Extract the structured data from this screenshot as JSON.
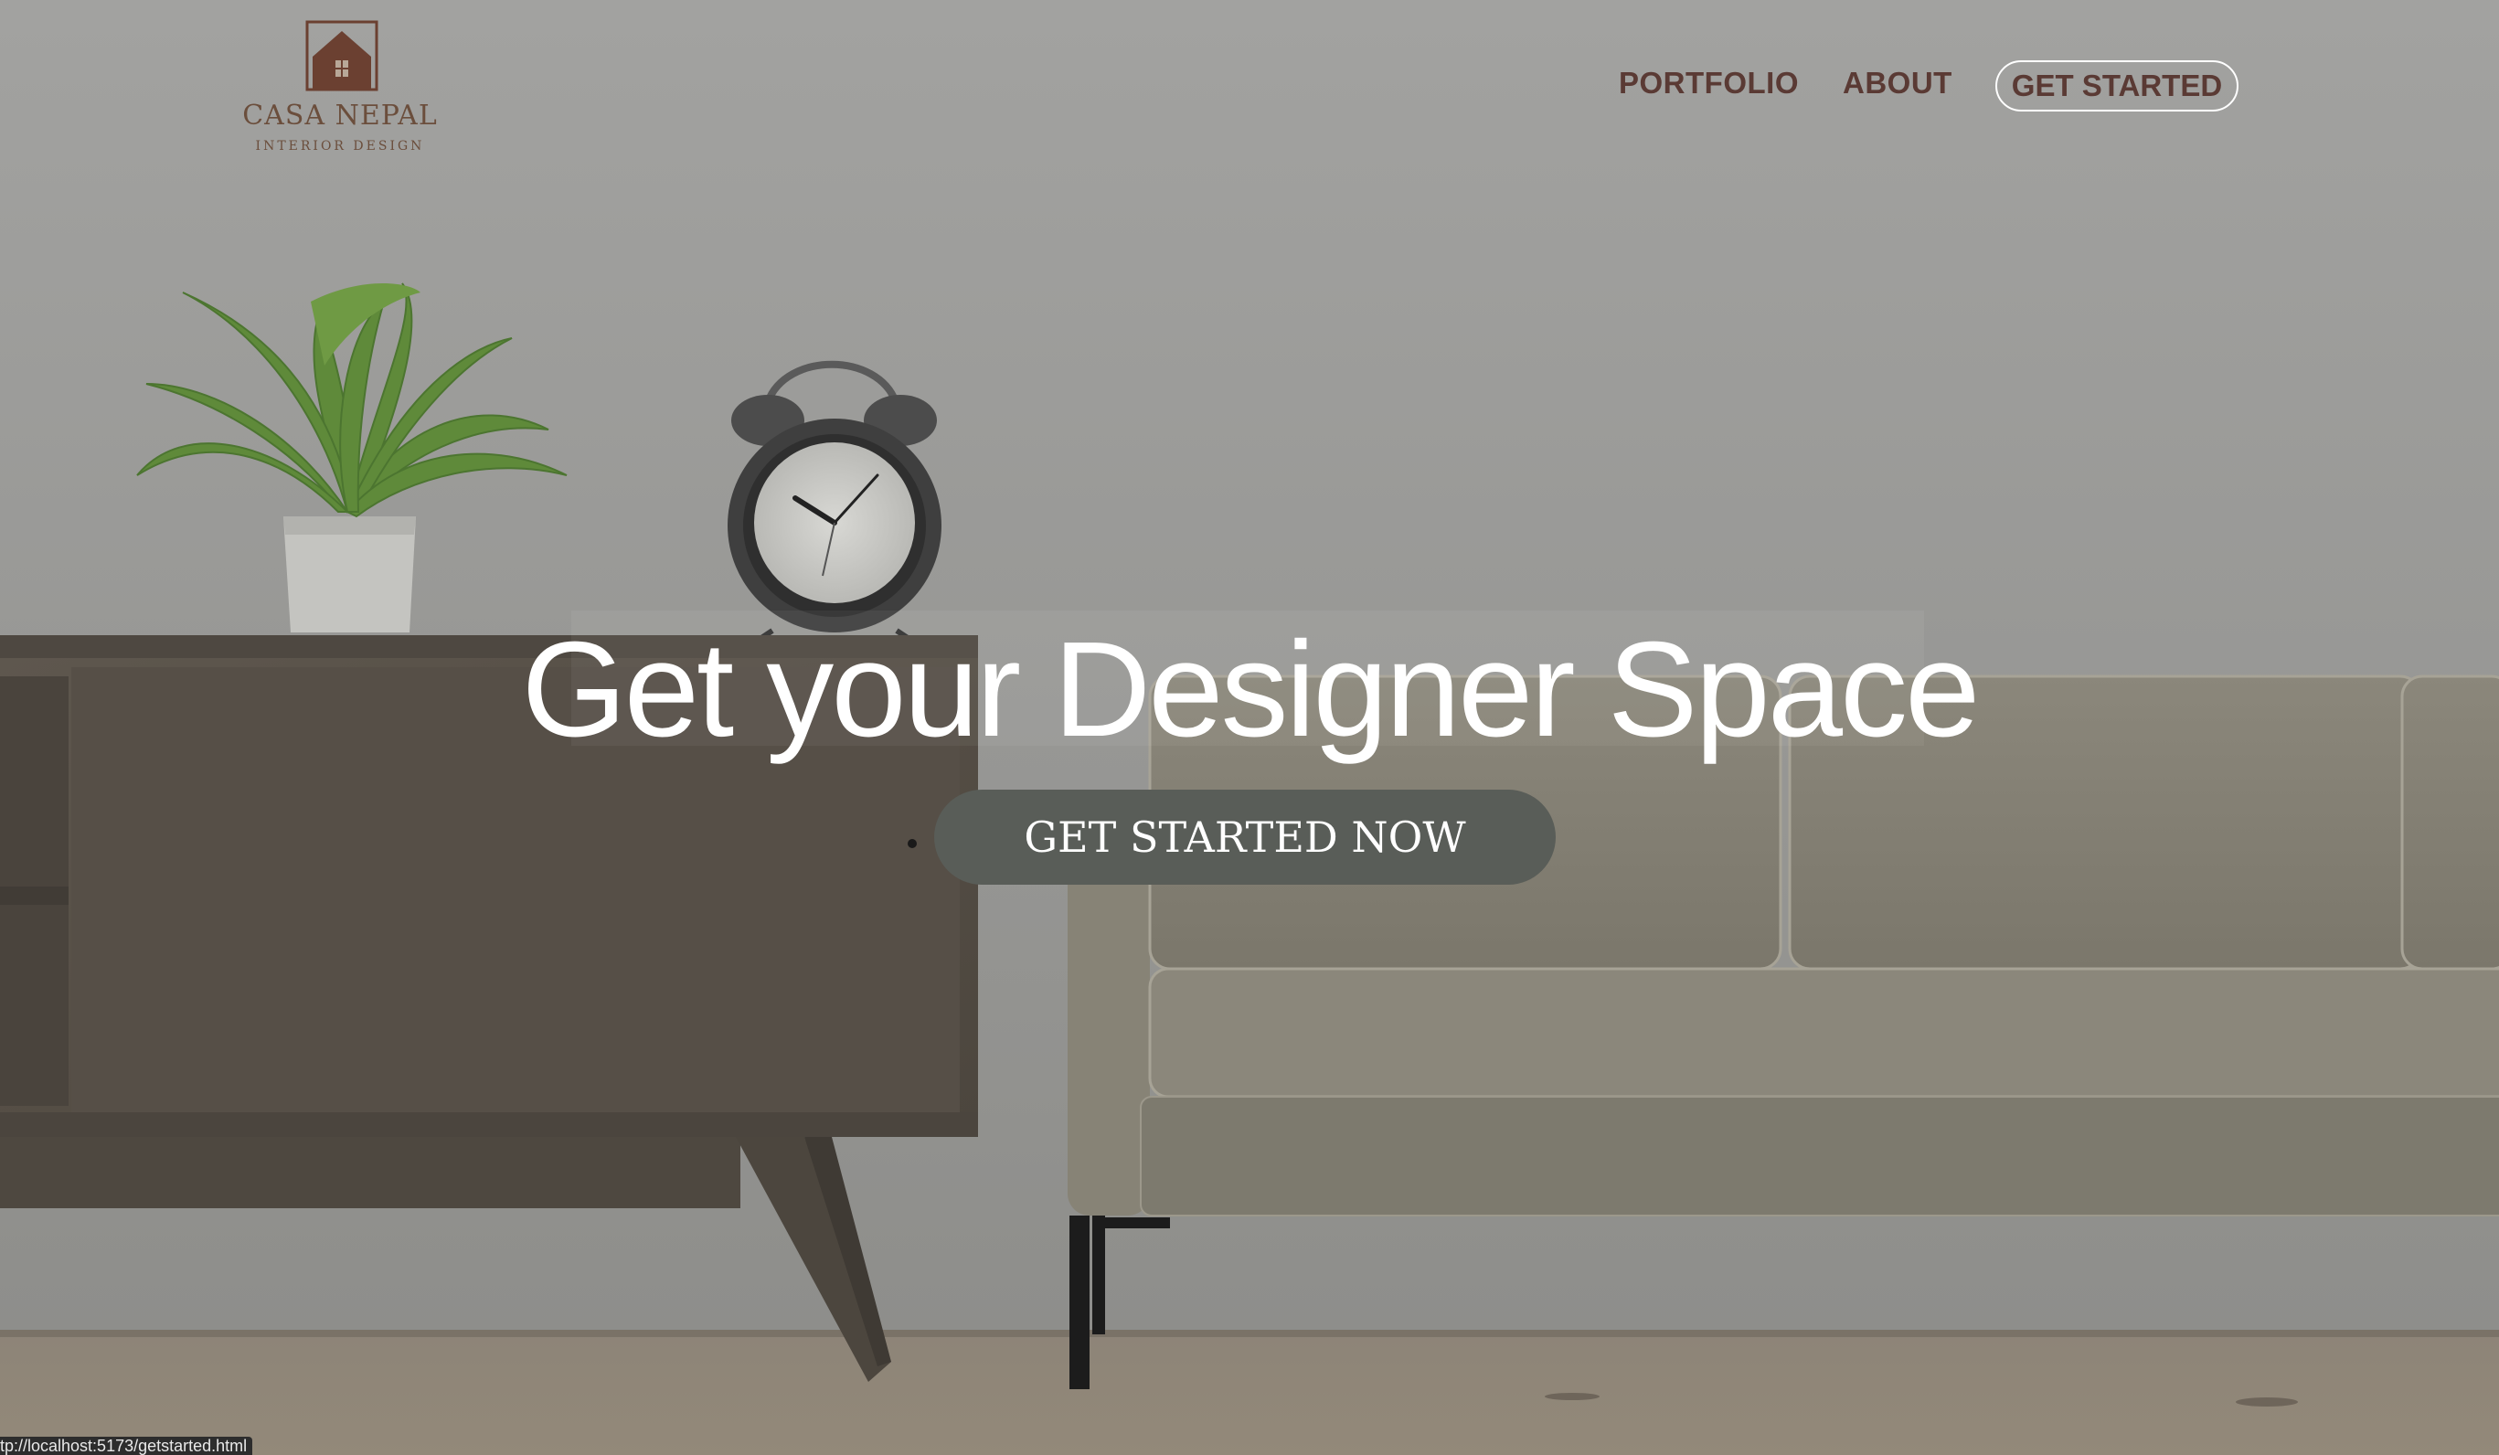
{
  "brand": {
    "name": "CASA NEPAL",
    "tagline": "INTERIOR DESIGN",
    "logo_color": "#6b4031"
  },
  "nav": {
    "items": [
      {
        "label": "PORTFOLIO"
      },
      {
        "label": "ABOUT"
      }
    ],
    "cta_label": "GET STARTED"
  },
  "hero": {
    "title": "Get your Designer Space",
    "cta_label": "GET STARTED NOW"
  },
  "status_bar": {
    "url": "tp://localhost:5173/getstarted.html"
  },
  "colors": {
    "nav_text": "#5a3a34",
    "cta_bg": "#595d58",
    "wall": "#9c9c9a"
  }
}
